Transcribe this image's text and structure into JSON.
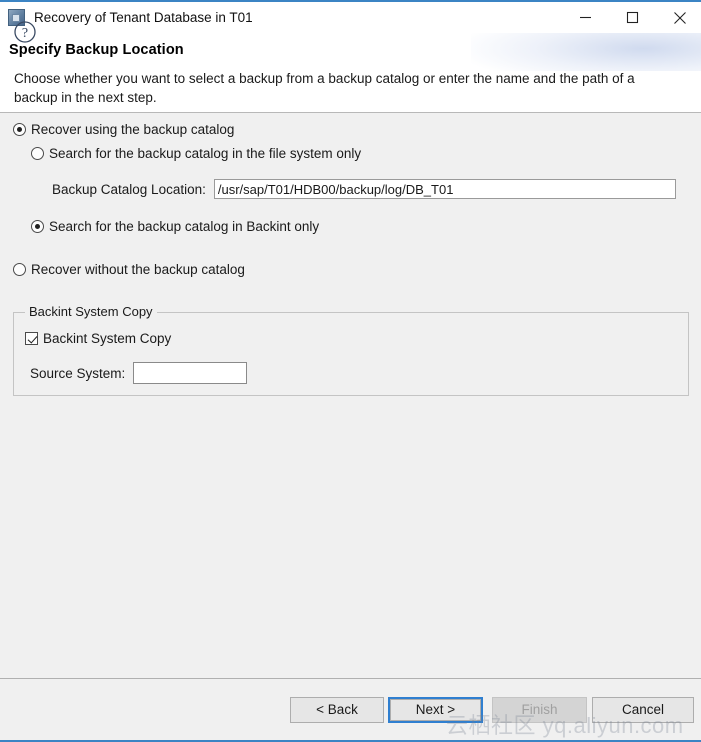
{
  "window": {
    "title": "Recovery of Tenant Database in T01",
    "app_icon": "database-window-icon",
    "controls": {
      "minimize": "minimize-icon",
      "maximize": "maximize-icon",
      "close": "close-icon"
    },
    "accent_color": "#3b84c4"
  },
  "header": {
    "title": "Specify Backup Location",
    "description": "Choose whether you want to select a backup from a backup catalog or enter the name and the path of a backup in the next step."
  },
  "options": {
    "use_catalog": {
      "label": "Recover using the backup catalog",
      "checked": true
    },
    "file_system_only": {
      "label": "Search for the backup catalog in the file system only",
      "checked": false
    },
    "catalog_location": {
      "label": "Backup Catalog Location:",
      "value": "/usr/sap/T01/HDB00/backup/log/DB_T01",
      "placeholder": ""
    },
    "backint_only": {
      "label": "Search for the backup catalog in Backint only",
      "checked": true
    },
    "without_catalog": {
      "label": "Recover without the backup catalog",
      "checked": false
    }
  },
  "backint_group": {
    "legend": "Backint System Copy",
    "checkbox": {
      "label": "Backint System Copy",
      "checked": true
    },
    "source_system": {
      "label": "Source System:",
      "value": "",
      "placeholder": ""
    }
  },
  "footer": {
    "help_icon": "help-question-icon",
    "buttons": {
      "back": "< Back",
      "next": "Next >",
      "finish": "Finish",
      "cancel": "Cancel"
    },
    "finish_enabled": false,
    "next_focused": true
  },
  "watermark": {
    "text": "云栖社区 yq.aliyun.com"
  }
}
